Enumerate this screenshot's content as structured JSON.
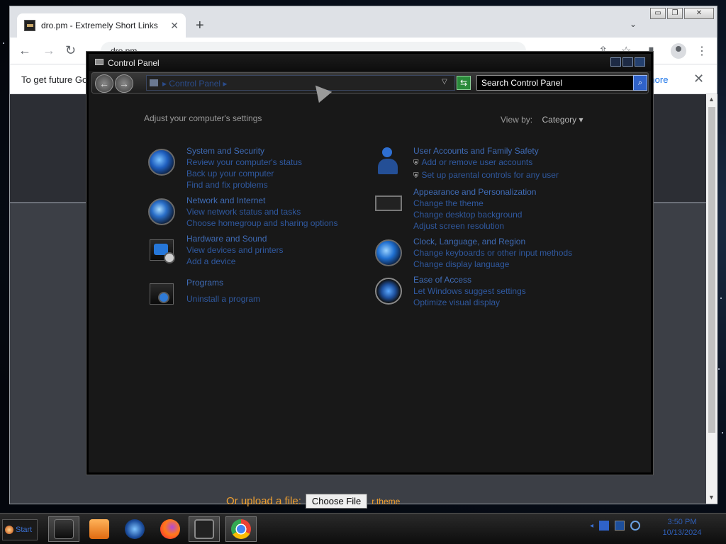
{
  "browser": {
    "tab_title": "dro.pm - Extremely Short Links",
    "tab_close": "✕",
    "new_tab": "+",
    "address": "dro.pm",
    "infobar_text": "To get future Go",
    "infobar_link": "n more",
    "infobar_close": "✕",
    "upload_label": "Or upload a file:",
    "upload_button": "Choose File",
    "upload_filename": "r.theme"
  },
  "control_panel": {
    "title": "Control Panel",
    "address": "▸ Control Panel ▸",
    "search_placeholder": "Search Control Panel",
    "heading": "Adjust your computer's settings",
    "view_by_label": "View by:",
    "view_by_value": "Category ▾",
    "left_categories": [
      {
        "title": "System and Security",
        "links": [
          "Review your computer's status",
          "Back up your computer",
          "Find and fix problems"
        ]
      },
      {
        "title": "Network and Internet",
        "links": [
          "View network status and tasks",
          "Choose homegroup and sharing options"
        ]
      },
      {
        "title": "Hardware and Sound",
        "links": [
          "View devices and printers",
          "Add a device"
        ]
      },
      {
        "title": "Programs",
        "links": [
          "Uninstall a program"
        ]
      }
    ],
    "right_categories": [
      {
        "title": "User Accounts and Family Safety",
        "links": [
          "Add or remove user accounts",
          "Set up parental controls for any user"
        ]
      },
      {
        "title": "Appearance and Personalization",
        "links": [
          "Change the theme",
          "Change desktop background",
          "Adjust screen resolution"
        ]
      },
      {
        "title": "Clock, Language, and Region",
        "links": [
          "Change keyboards or other input methods",
          "Change display language"
        ]
      },
      {
        "title": "Ease of Access",
        "links": [
          "Let Windows suggest settings",
          "Optimize visual display"
        ]
      }
    ]
  },
  "taskbar": {
    "start_label": "Start",
    "clock_time": "3:50 PM",
    "clock_date": "10/13/2024"
  }
}
